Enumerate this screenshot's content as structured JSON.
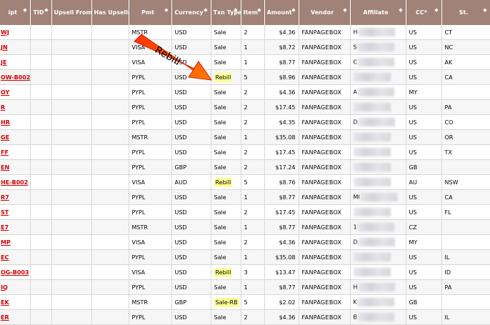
{
  "headers": [
    {
      "label": "ipt",
      "sortable": true
    },
    {
      "label": "TID",
      "sortable": true
    },
    {
      "label": "Upsell From",
      "sortable": false
    },
    {
      "label": "Has Upsells",
      "sortable": false
    },
    {
      "label": "Pmt",
      "sortable": true
    },
    {
      "label": "Currency",
      "sortable": true
    },
    {
      "label": "Txn Type",
      "sortable": true
    },
    {
      "label": "Item",
      "sortable": true
    },
    {
      "label": "Amount",
      "sortable": true
    },
    {
      "label": "Vendor",
      "sortable": true
    },
    {
      "label": "Affiliate",
      "sortable": true
    },
    {
      "label": "CC*",
      "sortable": true
    },
    {
      "label": "St.",
      "sortable": true
    }
  ],
  "sort_glyph": "◆",
  "rows": [
    {
      "receipt": "WJ",
      "pmt": "MSTR",
      "currency": "USD",
      "txn": "Sale",
      "item": "2",
      "amount": "$4.36",
      "vendor": "FANPAGEBOX",
      "affiliate": "H",
      "affiliate_blurred": true,
      "cc": "US",
      "st": "CT"
    },
    {
      "receipt": "JN",
      "pmt": "VISA",
      "currency": "USD",
      "txn": "Sale",
      "item": "1",
      "amount": "$8.72",
      "vendor": "FANPAGEBOX",
      "affiliate": "S",
      "affiliate_blurred": true,
      "cc": "US",
      "st": "NC"
    },
    {
      "receipt": "JE",
      "pmt": "VISA",
      "currency": "USD",
      "txn": "Sale",
      "item": "1",
      "amount": "$8.77",
      "vendor": "FANPAGEBOX",
      "affiliate": "C",
      "affiliate_blurred": true,
      "cc": "US",
      "st": "AK"
    },
    {
      "receipt": "OW-B002",
      "pmt": "PYPL",
      "currency": "USD",
      "txn": "Rebill",
      "txn_highlight": true,
      "item": "5",
      "amount": "$8.96",
      "vendor": "FANPAGEBOX",
      "affiliate": "",
      "affiliate_blurred": true,
      "cc": "US",
      "st": "CA"
    },
    {
      "receipt": "OY",
      "pmt": "PYPL",
      "currency": "USD",
      "txn": "Sale",
      "item": "2",
      "amount": "$4.36",
      "vendor": "FANPAGEBOX",
      "affiliate": "A",
      "affiliate_blurred": true,
      "cc": "MY",
      "st": ""
    },
    {
      "receipt": "R",
      "pmt": "PYPL",
      "currency": "USD",
      "txn": "Sale",
      "item": "2",
      "amount": "$17.45",
      "vendor": "FANPAGEBOX",
      "affiliate": "",
      "affiliate_blurred": true,
      "cc": "US",
      "st": "PA"
    },
    {
      "receipt": "HR",
      "pmt": "PYPL",
      "currency": "USD",
      "txn": "Sale",
      "item": "2",
      "amount": "$4.35",
      "vendor": "FANPAGEBOX",
      "affiliate": "D",
      "affiliate_blurred": true,
      "cc": "US",
      "st": "CO"
    },
    {
      "receipt": "GE",
      "pmt": "MSTR",
      "currency": "USD",
      "txn": "Sale",
      "item": "1",
      "amount": "$35.08",
      "vendor": "FANPAGEBOX",
      "affiliate": "",
      "affiliate_blurred": true,
      "cc": "US",
      "st": "OR"
    },
    {
      "receipt": "FF",
      "pmt": "PYPL",
      "currency": "USD",
      "txn": "Sale",
      "item": "2",
      "amount": "$17.45",
      "vendor": "FANPAGEBOX",
      "affiliate": "",
      "affiliate_blurred": true,
      "cc": "US",
      "st": "TX"
    },
    {
      "receipt": "EN",
      "pmt": "PYPL",
      "currency": "GBP",
      "txn": "Sale",
      "item": "2",
      "amount": "$17.24",
      "vendor": "FANPAGEBOX",
      "affiliate": "",
      "affiliate_blurred": true,
      "cc": "GB",
      "st": ""
    },
    {
      "receipt": "HE-B002",
      "pmt": "VISA",
      "currency": "AUD",
      "txn": "Rebill",
      "txn_highlight": true,
      "item": "5",
      "amount": "$8.76",
      "vendor": "FANPAGEBOX",
      "affiliate": "",
      "affiliate_blurred": true,
      "cc": "AU",
      "st": "NSW"
    },
    {
      "receipt": "R7",
      "pmt": "PYPL",
      "currency": "USD",
      "txn": "Sale",
      "item": "1",
      "amount": "$8.77",
      "vendor": "FANPAGEBOX",
      "affiliate": "MI",
      "affiliate_blurred": true,
      "cc": "US",
      "st": "CA"
    },
    {
      "receipt": "ST",
      "pmt": "PYPL",
      "currency": "USD",
      "txn": "Sale",
      "item": "2",
      "amount": "$17.45",
      "vendor": "FANPAGEBOX",
      "affiliate": "",
      "affiliate_blurred": true,
      "cc": "US",
      "st": "FL"
    },
    {
      "receipt": "E7",
      "pmt": "MSTR",
      "currency": "USD",
      "txn": "Sale",
      "item": "1",
      "amount": "$8.77",
      "vendor": "FANPAGEBOX",
      "affiliate": "1",
      "affiliate_blurred": true,
      "cc": "CZ",
      "st": ""
    },
    {
      "receipt": "MP",
      "pmt": "VISA",
      "currency": "USD",
      "txn": "Sale",
      "item": "2",
      "amount": "$4.36",
      "vendor": "FANPAGEBOX",
      "affiliate": "D",
      "affiliate_blurred": true,
      "cc": "MY",
      "st": ""
    },
    {
      "receipt": "EC",
      "pmt": "PYPL",
      "currency": "USD",
      "txn": "Sale",
      "item": "1",
      "amount": "$35.08",
      "vendor": "FANPAGEBOX",
      "affiliate": "",
      "affiliate_blurred": true,
      "cc": "US",
      "st": "IL"
    },
    {
      "receipt": "OG-B003",
      "pmt": "VISA",
      "currency": "USD",
      "txn": "Rebill",
      "txn_highlight": true,
      "item": "3",
      "amount": "$13.47",
      "vendor": "FANPAGEBOX",
      "affiliate": "",
      "affiliate_blurred": true,
      "cc": "US",
      "st": "ID"
    },
    {
      "receipt": "IQ",
      "pmt": "PYPL",
      "currency": "USD",
      "txn": "Sale",
      "item": "1",
      "amount": "$8.77",
      "vendor": "FANPAGEBOX",
      "affiliate": "H",
      "affiliate_blurred": true,
      "cc": "US",
      "st": "PA"
    },
    {
      "receipt": "EK",
      "pmt": "MSTR",
      "currency": "GBP",
      "txn": "Sale-RB",
      "txn_highlight": true,
      "item": "5",
      "amount": "$2.02",
      "vendor": "FANPAGEBOX",
      "affiliate": "K",
      "affiliate_blurred": true,
      "cc": "GB",
      "st": ""
    },
    {
      "receipt": "ER",
      "pmt": "PYPL",
      "currency": "USD",
      "txn": "Sale",
      "item": "2",
      "amount": "$4.36",
      "vendor": "FANPAGEBOX",
      "affiliate": "B",
      "affiliate_blurred": true,
      "cc": "US",
      "st": "IL"
    }
  ],
  "annotation": {
    "text": "Rebill",
    "arrow_color": "#ff3300"
  },
  "colors": {
    "header_bg": "#a08278",
    "receipt_link": "#cc0000",
    "highlight": "#ffff99"
  }
}
